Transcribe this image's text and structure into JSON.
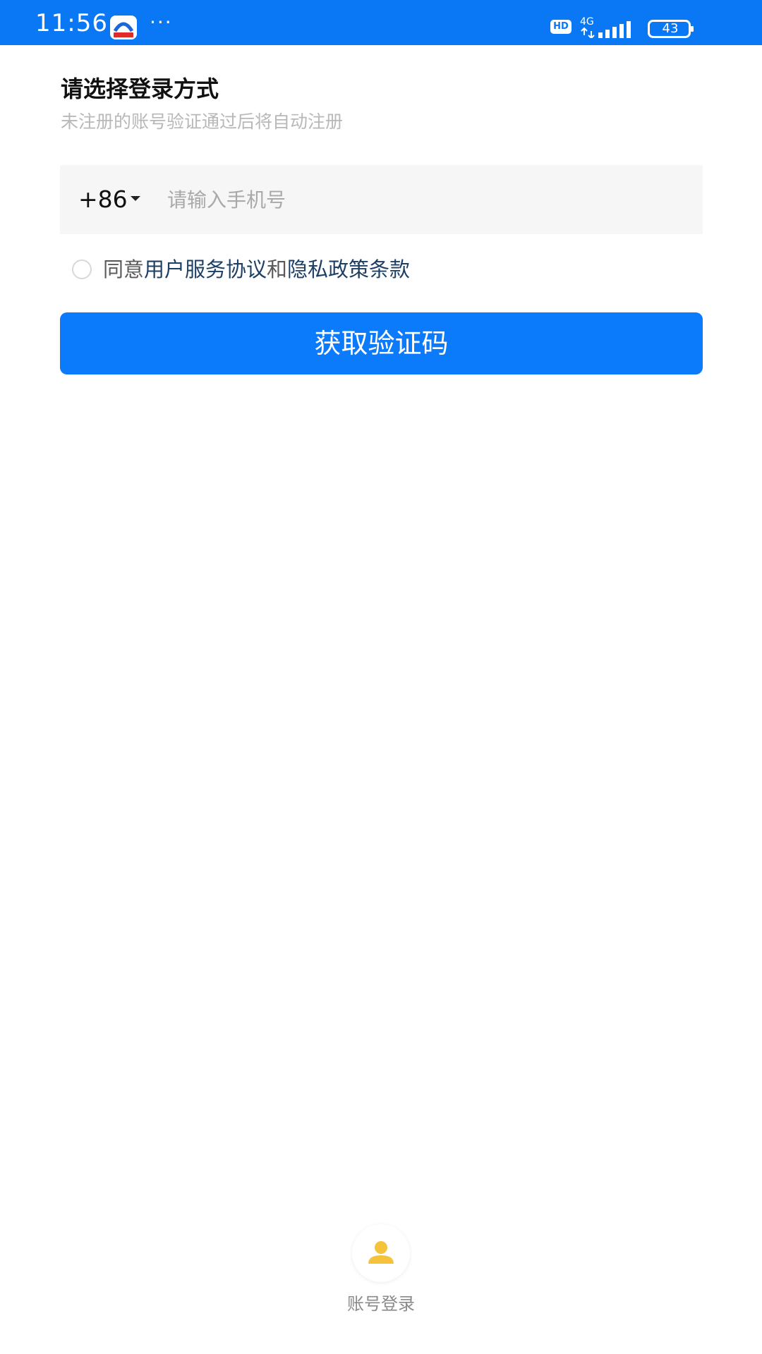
{
  "status_bar": {
    "time": "11:56",
    "dots": "···",
    "hd_label": "HD",
    "network_type": "4G",
    "battery_level": "43",
    "accent_color": "#0a78f5"
  },
  "login": {
    "title": "请选择登录方式",
    "subtitle": "未注册的账号验证通过后将自动注册",
    "country_code": "+86",
    "phone_placeholder": "请输入手机号",
    "agree_prefix": "同意",
    "user_agreement": "用户服务协议",
    "agree_and": "和",
    "privacy_policy": "隐私政策条款",
    "get_code_button": "获取验证码",
    "button_color": "#0b7bfb"
  },
  "alt_login": {
    "account_label": "账号登录",
    "icon": "person-icon",
    "icon_color": "#f5c33b"
  }
}
